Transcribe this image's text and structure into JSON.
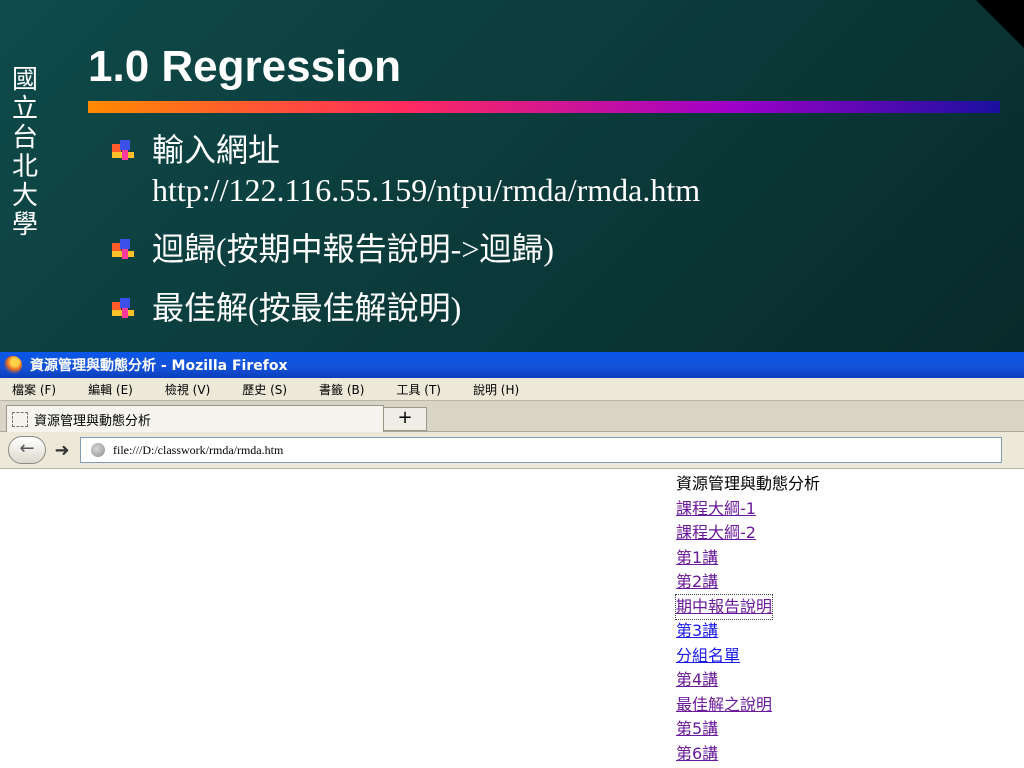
{
  "slide": {
    "vertical_title": [
      "國",
      "立",
      "台",
      "北",
      "大",
      "學"
    ],
    "title": "1.0 Regression",
    "bullets": [
      {
        "lines": [
          "輸入網址",
          "http://122.116.55.159/ntpu/rmda/rmda.htm"
        ]
      },
      {
        "lines": [
          "迴歸(按期中報告說明->迴歸)"
        ]
      },
      {
        "lines": [
          "最佳解(按最佳解說明)"
        ]
      }
    ]
  },
  "browser": {
    "window_title": "資源管理與動態分析 - Mozilla Firefox",
    "menu": [
      "檔案 (F)",
      "編輯 (E)",
      "檢視 (V)",
      "歷史 (S)",
      "書籤 (B)",
      "工具 (T)",
      "說明 (H)"
    ],
    "tab_title": "資源管理與動態分析",
    "new_tab": "+",
    "url": "file:///D:/classwork/rmda/rmda.htm",
    "back_icon": "arrow-left",
    "forward_icon": "arrow-right"
  },
  "page": {
    "heading": "資源管理與動態分析",
    "links": [
      "課程大綱-1",
      "課程大綱-2",
      "第1講",
      "第2講",
      "期中報告說明",
      "第3講",
      "分組名單",
      "第4講",
      "最佳解之說明",
      "第5講",
      "第6講"
    ]
  },
  "colors": {
    "link": "#1a1ae8",
    "visited_link": "#6a1a9a",
    "titlebar": "#0a56e8",
    "slide_bg": "#0a3434"
  }
}
